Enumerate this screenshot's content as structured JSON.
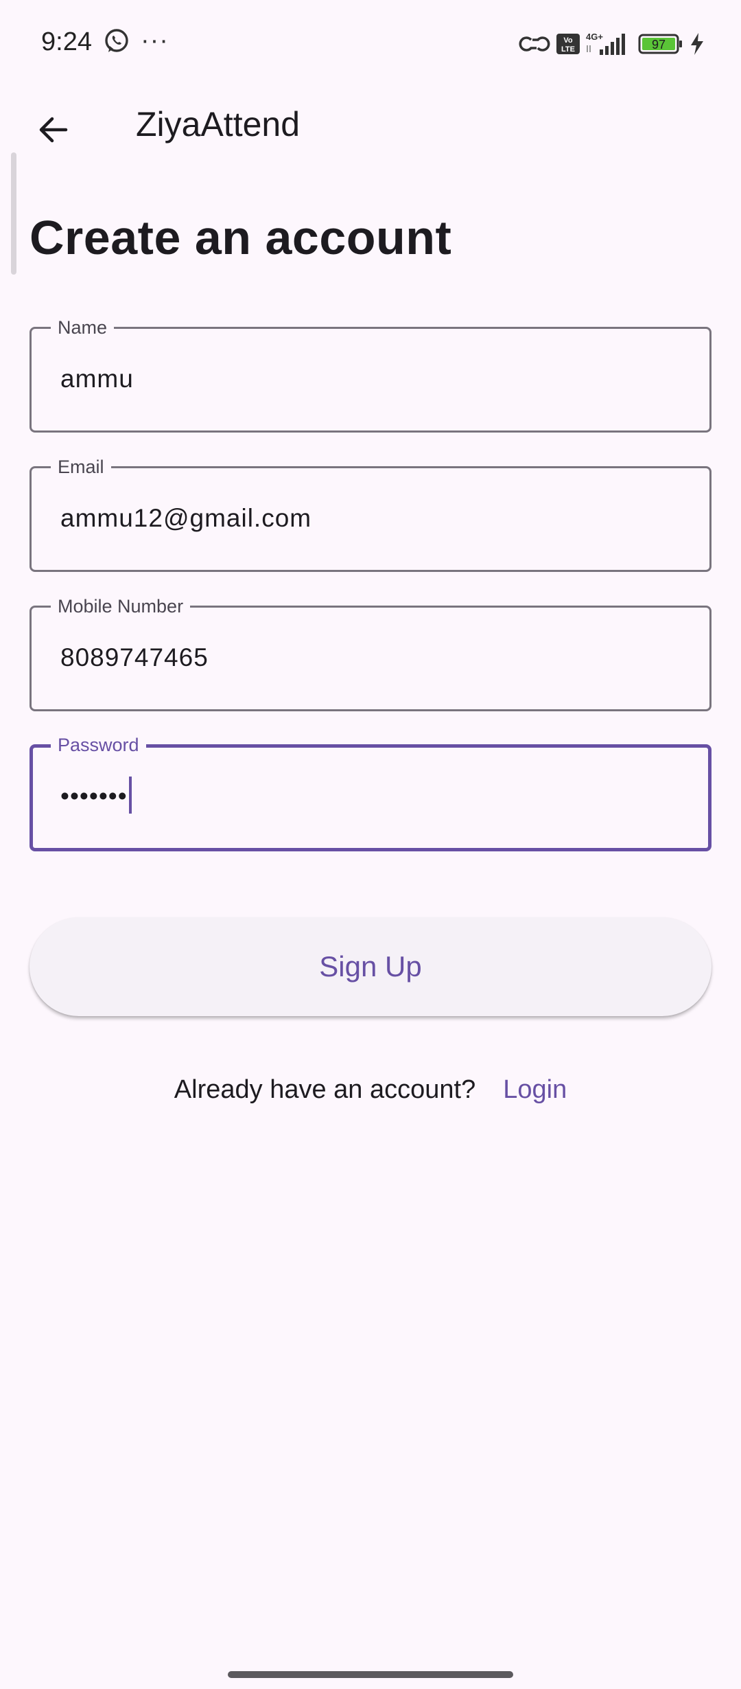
{
  "status_bar": {
    "time": "9:24",
    "dots": "···",
    "battery_level": "97",
    "network": "4G+",
    "volte_label": "Vo LTE"
  },
  "app_bar": {
    "title": "ZiyaAttend"
  },
  "heading": "Create an account",
  "form": {
    "name": {
      "label": "Name",
      "value": "ammu"
    },
    "email": {
      "label": "Email",
      "value": "ammu12@gmail.com"
    },
    "mobile": {
      "label": "Mobile Number",
      "value": "8089747465"
    },
    "password": {
      "label": "Password",
      "value": "•••••••"
    }
  },
  "signup_button": "Sign Up",
  "login_prompt": "Already have an account?",
  "login_link": "Login",
  "colors": {
    "accent": "#6750a4",
    "background": "#fdf7fd",
    "outline": "#79747e",
    "battery_fill": "#5ac437"
  }
}
